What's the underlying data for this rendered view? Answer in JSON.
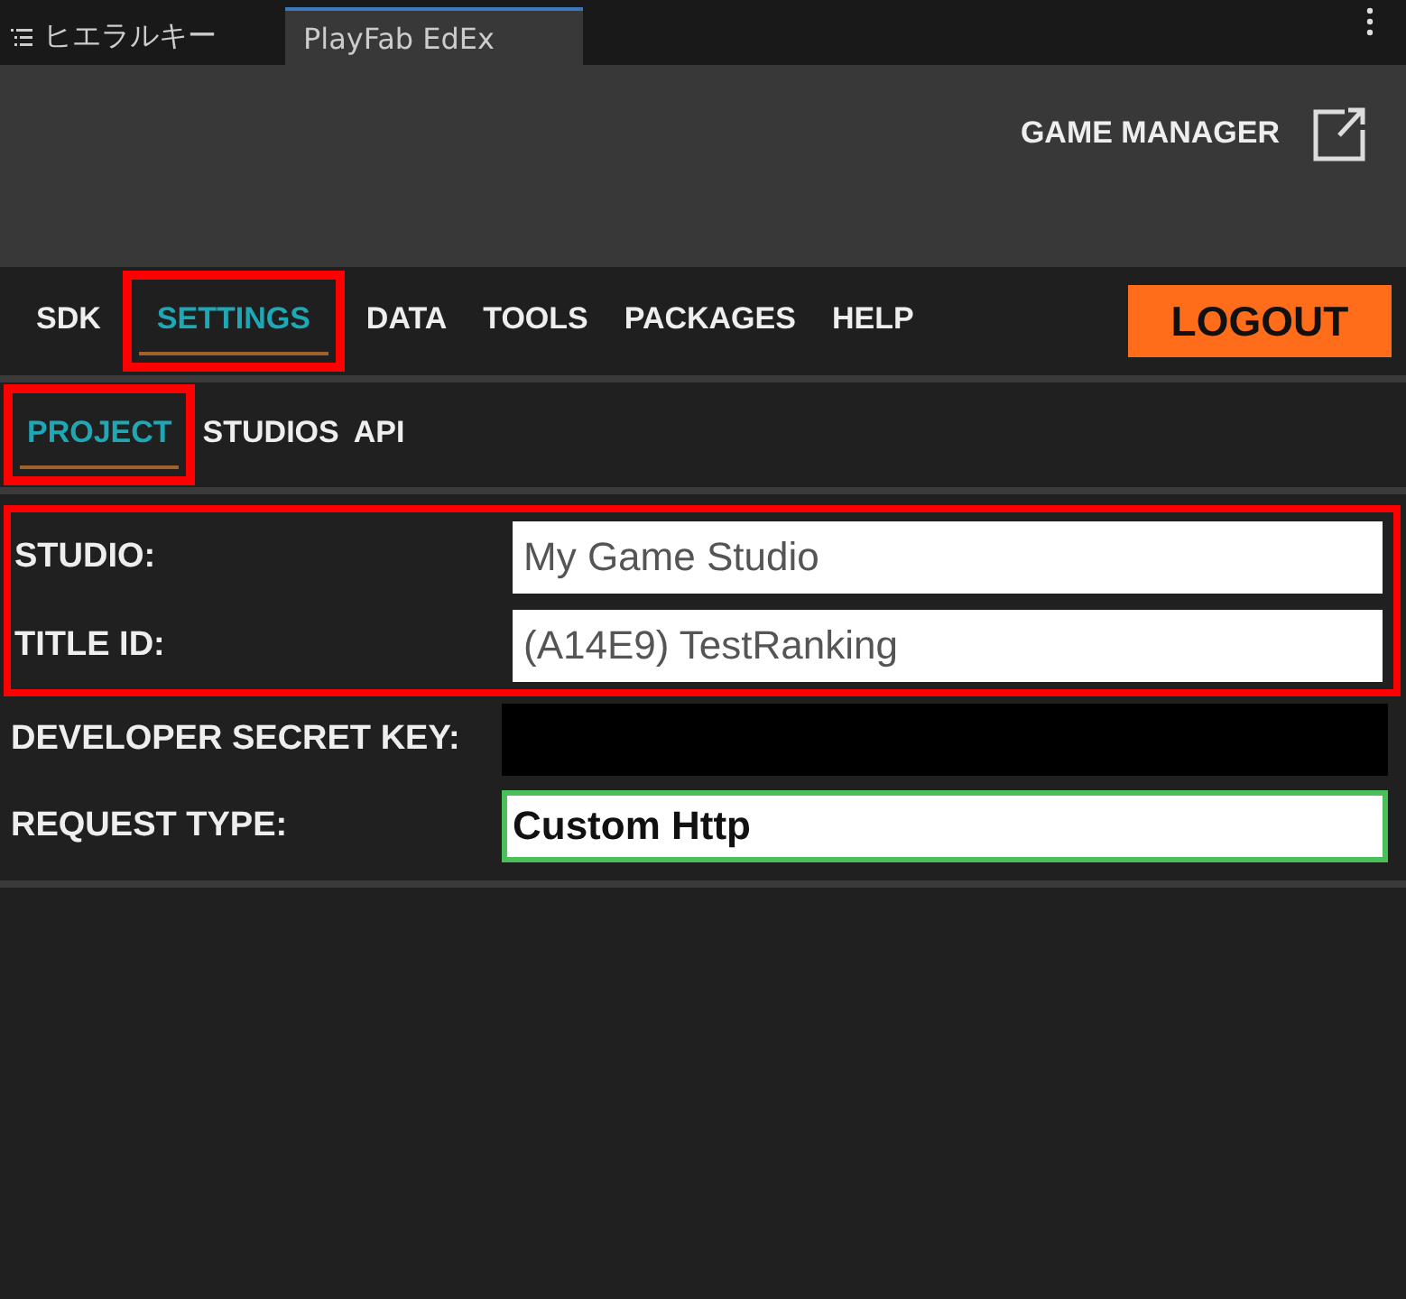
{
  "window_tabs": [
    {
      "label": "ヒエラルキー",
      "selected": false,
      "kind": "hierarchy"
    },
    {
      "label": "PlayFab EdEx",
      "selected": true
    }
  ],
  "header": {
    "link": "GAME MANAGER"
  },
  "nav": [
    {
      "label": "SDK",
      "selected": false,
      "highlighted": false
    },
    {
      "label": "SETTINGS",
      "selected": true,
      "highlighted": true
    },
    {
      "label": "DATA",
      "selected": false,
      "highlighted": false
    },
    {
      "label": "TOOLS",
      "selected": false,
      "highlighted": false
    },
    {
      "label": "PACKAGES",
      "selected": false,
      "highlighted": false
    },
    {
      "label": "HELP",
      "selected": false,
      "highlighted": false
    }
  ],
  "logout_button": "LOGOUT",
  "subnav": [
    {
      "label": "PROJECT",
      "selected": true,
      "highlighted": true
    },
    {
      "label": "STUDIOS",
      "selected": false,
      "highlighted": false
    },
    {
      "label": "API",
      "selected": false,
      "highlighted": false
    }
  ],
  "fields": [
    {
      "label": "STUDIO:",
      "kind": "text",
      "value": "My Game Studio",
      "focused": false,
      "highlighted": true
    },
    {
      "label": "TITLE ID:",
      "kind": "text",
      "value": "(A14E9) TestRanking",
      "focused": false,
      "highlighted": true
    },
    {
      "label": "DEVELOPER SECRET KEY:",
      "kind": "redacted",
      "highlighted": false
    },
    {
      "label": "REQUEST TYPE:",
      "kind": "text",
      "value": "Custom Http",
      "focused": true,
      "highlighted": false
    }
  ]
}
